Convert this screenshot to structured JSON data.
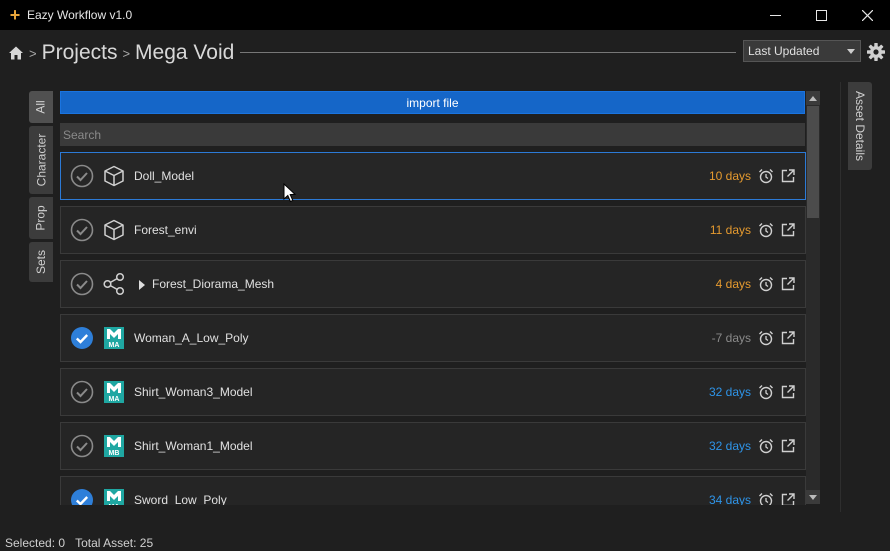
{
  "window": {
    "title": "Eazy Workflow v1.0",
    "controls": [
      "minimize",
      "maximize",
      "close"
    ]
  },
  "breadcrumb": {
    "separator": ">",
    "items": [
      "Projects",
      "Mega Void"
    ]
  },
  "sort": {
    "selected": "Last Updated"
  },
  "left_tabs": [
    "All",
    "Character",
    "Prop",
    "Sets"
  ],
  "right_tab": "Asset Details",
  "import_button": "import file",
  "search": {
    "placeholder": "Search",
    "value": ""
  },
  "assets": [
    {
      "name": "Doll_Model",
      "age": "10 days",
      "age_color": "orange",
      "type": "cube-icon",
      "checked": false
    },
    {
      "name": "Forest_envi",
      "age": "11 days",
      "age_color": "orange",
      "type": "cube-icon",
      "checked": false
    },
    {
      "name": "Forest_Diorama_Mesh",
      "age": "4 days",
      "age_color": "orange",
      "type": "share-nodes-icon",
      "checked": false,
      "expandable": true
    },
    {
      "name": "Woman_A_Low_Poly",
      "age": "-7 days",
      "age_color": "gray",
      "type": "maya-ma-icon",
      "checked": true
    },
    {
      "name": "Shirt_Woman3_Model",
      "age": "32 days",
      "age_color": "blue",
      "type": "maya-ma-icon",
      "checked": false
    },
    {
      "name": "Shirt_Woman1_Model",
      "age": "32 days",
      "age_color": "blue",
      "type": "maya-mb-icon",
      "checked": false
    },
    {
      "name": "Sword_Low_Poly",
      "age": "34 days",
      "age_color": "blue",
      "type": "maya-ma-icon",
      "checked": true
    }
  ],
  "status": {
    "selected_label": "Selected:",
    "selected_value": "0",
    "total_label": "Total Asset:",
    "total_value": "25"
  },
  "colors": {
    "accent": "#1566c8",
    "check_blue": "#2e7fd9",
    "orange": "#e59a2f",
    "blue": "#2e94e8",
    "maya_teal": "#1fa7a2"
  }
}
